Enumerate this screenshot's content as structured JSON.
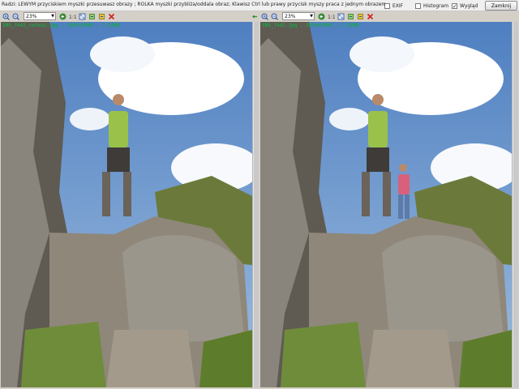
{
  "header": {
    "hint": "Radzi: LEWYM przyciskiem myszki przesuwasz obrazy ; ROLKA myszki przybliża/oddala obraz; Klawisz Ctrl lub prawy przycisk myszy praca z jednym obrazem.",
    "options": [
      {
        "label": "EXIF",
        "checked": false
      },
      {
        "label": "Histogram",
        "checked": false
      },
      {
        "label": "Wygląd",
        "checked": true
      }
    ],
    "close_label": "Zamknij"
  },
  "toolbar": {
    "zoom": "23%",
    "icons": [
      "zoom-in-icon",
      "zoom-out-icon",
      "prev-icon",
      "actual-size-icon",
      "fit-icon",
      "rotate-left-icon",
      "rotate-right-icon",
      "delete-icon"
    ]
  },
  "left_image": {
    "caption": "IMG_7442_retusz.jpg , 2592x3888 , 7.32MB"
  },
  "right_image": {
    "caption": "IMG_7442.jpg , 2592x3888 , 7.13MB"
  },
  "colors": {
    "caption": "#1aa64a",
    "sky": "#6a8fb8",
    "rock": "#7c766c"
  }
}
